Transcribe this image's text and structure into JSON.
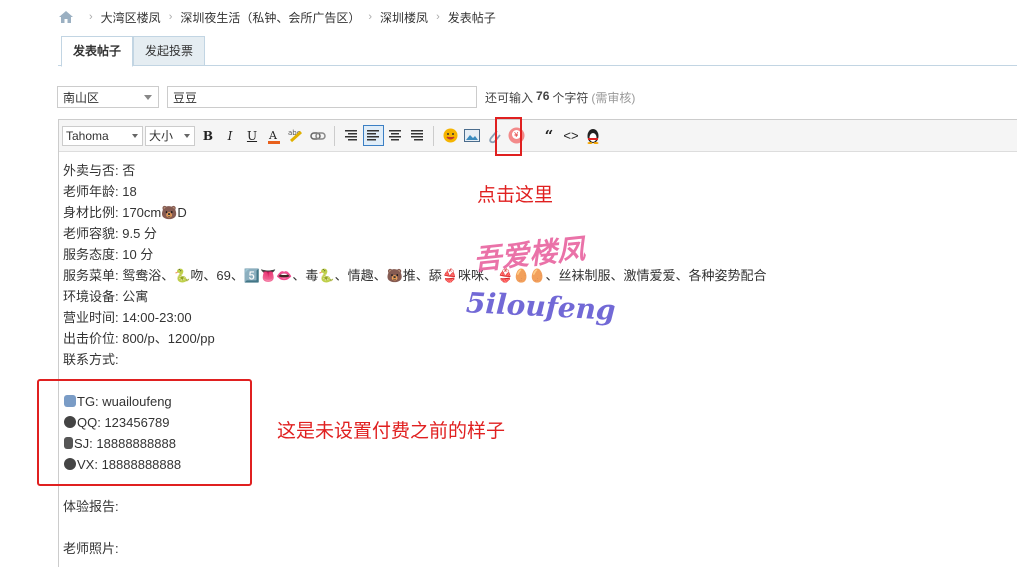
{
  "breadcrumb": {
    "items": [
      "大湾区楼凤",
      "深圳夜生活（私钟、会所广告区）",
      "深圳楼凤",
      "发表帖子"
    ]
  },
  "tabs": [
    "发表帖子",
    "发起投票"
  ],
  "subject": {
    "district": "南山区",
    "title": "豆豆",
    "remain_prefix": "还可输入",
    "remain_count": "76",
    "remain_suffix": "个字符",
    "review_note": "(需审核)"
  },
  "toolbar": {
    "font": "Tahoma",
    "size": "大小"
  },
  "content": {
    "lines": [
      "外卖与否:  否",
      "老师年龄:  18",
      "身材比例:  170cm🐻D",
      "老师容貌:  9.5 分",
      "服务态度:  10 分",
      "服务菜单:  鸳鸯浴、🐍吻、69、5️⃣👅👄、毒🐍、情趣、🐻推、舔👙咪咪、👙🥚🥚、丝袜制服、激情爱爱、各种姿势配合",
      "环境设备:  公寓",
      "营业时间:  14:00-23:00",
      "出击价位:  800/p、1200/pp",
      "联系方式:"
    ],
    "contacts": [
      {
        "icon": "airplane-icon",
        "text": "TG:  wuailoufeng"
      },
      {
        "icon": "penguin-icon",
        "text": "QQ: 123456789"
      },
      {
        "icon": "phone-icon",
        "text": "SJ: 18888888888"
      },
      {
        "icon": "penguin-icon",
        "text": "VX: 18888888888"
      }
    ],
    "report_label": "体验报告:",
    "photo_label": "老师照片:"
  },
  "annotations": {
    "click_here": "点击这里",
    "before_paid": "这是未设置付费之前的样子"
  },
  "watermark": {
    "cn": "吾爱楼凤",
    "en": "5iloufeng"
  },
  "colors": {
    "annotation_red": "#e02020",
    "tab_border": "#c2d5e3"
  }
}
